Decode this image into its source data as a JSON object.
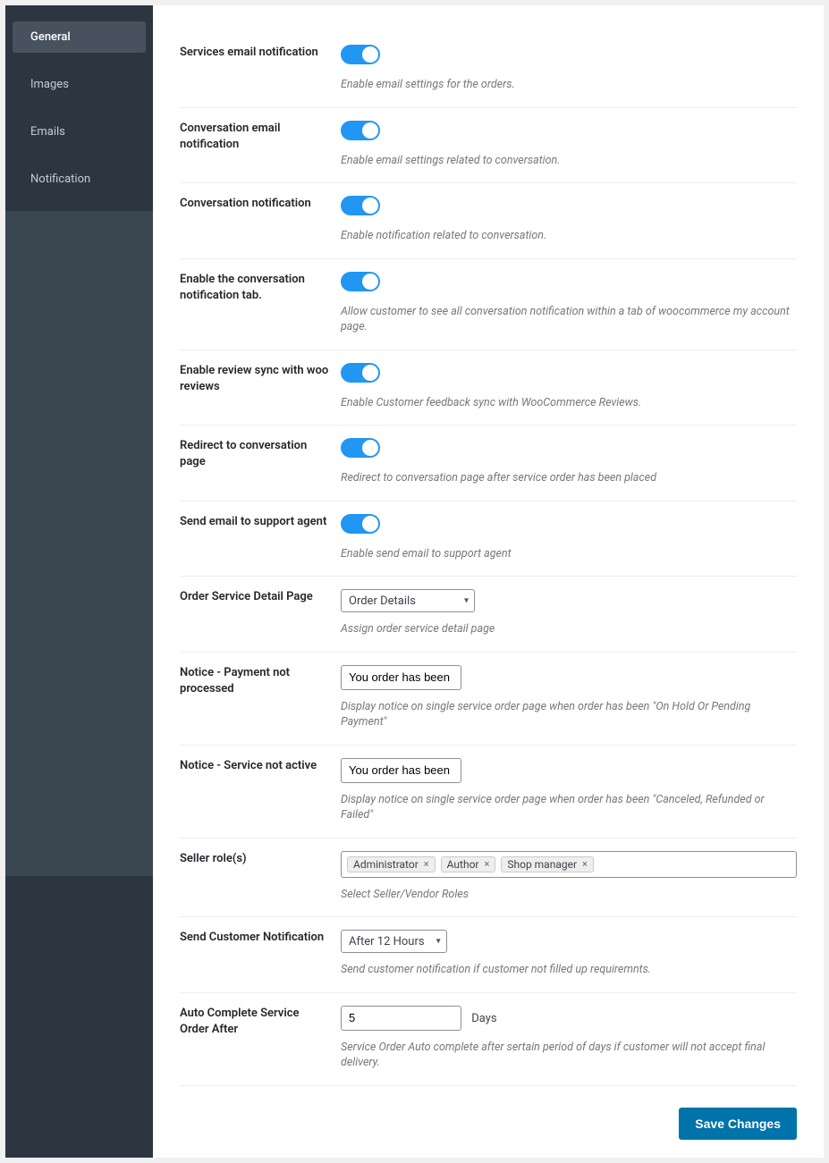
{
  "sidebar": {
    "items": [
      {
        "label": "General",
        "active": true
      },
      {
        "label": "Images",
        "active": false
      },
      {
        "label": "Emails",
        "active": false
      },
      {
        "label": "Notification",
        "active": false
      }
    ]
  },
  "settings": {
    "services_email": {
      "label": "Services email notification",
      "desc": "Enable email settings for the orders."
    },
    "conv_email": {
      "label": "Conversation email notification",
      "desc": "Enable email settings related to conversation."
    },
    "conv_notif": {
      "label": "Conversation notification",
      "desc": "Enable notification related to conversation."
    },
    "conv_tab": {
      "label": "Enable the conversation notification tab.",
      "desc": "Allow customer to see all conversation notification within a tab of woocommerce my account page."
    },
    "review_sync": {
      "label": "Enable review sync with woo reviews",
      "desc": "Enable Customer feedback sync with WooCommerce Reviews."
    },
    "redirect": {
      "label": "Redirect to conversation page",
      "desc": "Redirect to conversation page after service order has been placed"
    },
    "support_email": {
      "label": "Send email to support agent",
      "desc": "Enable send email to support agent"
    },
    "detail_page": {
      "label": "Order Service Detail Page",
      "value": "Order Details",
      "desc": "Assign order service detail page"
    },
    "notice_payment": {
      "label": "Notice - Payment not processed",
      "value": "You order has been [ord",
      "desc": "Display notice on single service order page when order has been \"On Hold Or Pending Payment\""
    },
    "notice_service": {
      "label": "Notice - Service not active",
      "value": "You order has been [ord",
      "desc": "Display notice on single service order page when order has been \"Canceled, Refunded or Failed\""
    },
    "seller_roles": {
      "label": "Seller role(s)",
      "tags": [
        "Administrator",
        "Author",
        "Shop manager"
      ],
      "desc": "Select Seller/Vendor Roles"
    },
    "customer_notif": {
      "label": "Send Customer Notification",
      "value": "After 12 Hours",
      "desc": "Send customer notification if customer not filled up requiremnts."
    },
    "auto_complete": {
      "label": "Auto Complete Service Order After",
      "value": "5",
      "unit": "Days",
      "desc": "Service Order Auto complete after sertain period of days if customer will not accept final delivery."
    }
  },
  "save": {
    "label": "Save Changes"
  }
}
